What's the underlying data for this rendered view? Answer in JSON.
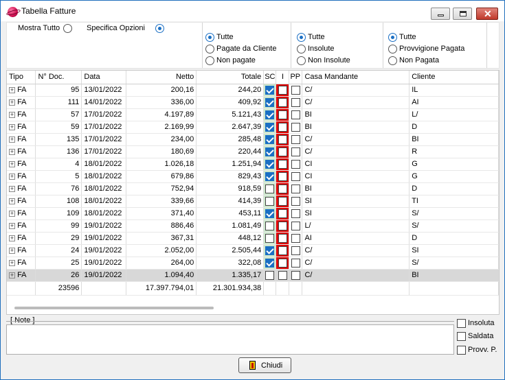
{
  "window": {
    "title": "Tabella Fatture"
  },
  "show_options": {
    "mostra_tutto": "Mostra Tutto",
    "specifica_opzioni": "Specifica Opzioni"
  },
  "filter_groups": [
    {
      "options": [
        "Tutte",
        "Pagate da Cliente",
        "Non pagate"
      ],
      "selected": 0
    },
    {
      "options": [
        "Tutte",
        "Insolute",
        "Non Insolute"
      ],
      "selected": 0
    },
    {
      "options": [
        "Tutte",
        "Provvigione Pagata",
        "Non Pagata"
      ],
      "selected": 0
    }
  ],
  "columns": [
    "Tipo",
    "N° Doc.",
    "Data",
    "Netto",
    "Totale",
    "SC",
    "I",
    "PP",
    "Casa Mandante",
    "Cliente"
  ],
  "rows": [
    {
      "tipo": "FA",
      "num": "95",
      "data": "13/01/2022",
      "netto": "200,16",
      "totale": "244,20",
      "sc": true,
      "casa": "C/",
      "cliente": "IL"
    },
    {
      "tipo": "FA",
      "num": "111",
      "data": "14/01/2022",
      "netto": "336,00",
      "totale": "409,92",
      "sc": true,
      "casa": "C/",
      "cliente": "AI"
    },
    {
      "tipo": "FA",
      "num": "57",
      "data": "17/01/2022",
      "netto": "4.197,89",
      "totale": "5.121,43",
      "sc": true,
      "casa": "BI",
      "cliente": "L/"
    },
    {
      "tipo": "FA",
      "num": "59",
      "data": "17/01/2022",
      "netto": "2.169,99",
      "totale": "2.647,39",
      "sc": true,
      "casa": "BI",
      "cliente": "D"
    },
    {
      "tipo": "FA",
      "num": "135",
      "data": "17/01/2022",
      "netto": "234,00",
      "totale": "285,48",
      "sc": true,
      "casa": "C/",
      "cliente": "BI"
    },
    {
      "tipo": "FA",
      "num": "136",
      "data": "17/01/2022",
      "netto": "180,69",
      "totale": "220,44",
      "sc": true,
      "casa": "C/",
      "cliente": "R"
    },
    {
      "tipo": "FA",
      "num": "4",
      "data": "18/01/2022",
      "netto": "1.026,18",
      "totale": "1.251,94",
      "sc": true,
      "casa": "CI",
      "cliente": "G"
    },
    {
      "tipo": "FA",
      "num": "5",
      "data": "18/01/2022",
      "netto": "679,86",
      "totale": "829,43",
      "sc": true,
      "casa": "CI",
      "cliente": "G"
    },
    {
      "tipo": "FA",
      "num": "76",
      "data": "18/01/2022",
      "netto": "752,94",
      "totale": "918,59",
      "sc": false,
      "casa": "BI",
      "cliente": "D"
    },
    {
      "tipo": "FA",
      "num": "108",
      "data": "18/01/2022",
      "netto": "339,66",
      "totale": "414,39",
      "sc": false,
      "casa": "SI",
      "cliente": "TI"
    },
    {
      "tipo": "FA",
      "num": "109",
      "data": "18/01/2022",
      "netto": "371,40",
      "totale": "453,11",
      "sc": true,
      "casa": "SI",
      "cliente": "S/"
    },
    {
      "tipo": "FA",
      "num": "99",
      "data": "19/01/2022",
      "netto": "886,46",
      "totale": "1.081,49",
      "sc": false,
      "casa": "L/",
      "cliente": "S/"
    },
    {
      "tipo": "FA",
      "num": "29",
      "data": "19/01/2022",
      "netto": "367,31",
      "totale": "448,12",
      "sc": false,
      "casa": "AI",
      "cliente": "D"
    },
    {
      "tipo": "FA",
      "num": "24",
      "data": "19/01/2022",
      "netto": "2.052,00",
      "totale": "2.505,44",
      "sc": true,
      "casa": "C/",
      "cliente": "SI"
    },
    {
      "tipo": "FA",
      "num": "25",
      "data": "19/01/2022",
      "netto": "264,00",
      "totale": "322,08",
      "sc": true,
      "casa": "C/",
      "cliente": "S/"
    },
    {
      "tipo": "FA",
      "num": "26",
      "data": "19/01/2022",
      "netto": "1.094,40",
      "totale": "1.335,17",
      "sc": false,
      "casa": "C/",
      "cliente": "BI"
    }
  ],
  "totals": {
    "num": "23596",
    "netto": "17.397.794,01",
    "totale": "21.301.934,38"
  },
  "notes": {
    "label": "[ Note ]",
    "value": ""
  },
  "note_checks": [
    "Insoluta",
    "Saldata",
    "Provv. P."
  ],
  "close_button": "Chiudi"
}
